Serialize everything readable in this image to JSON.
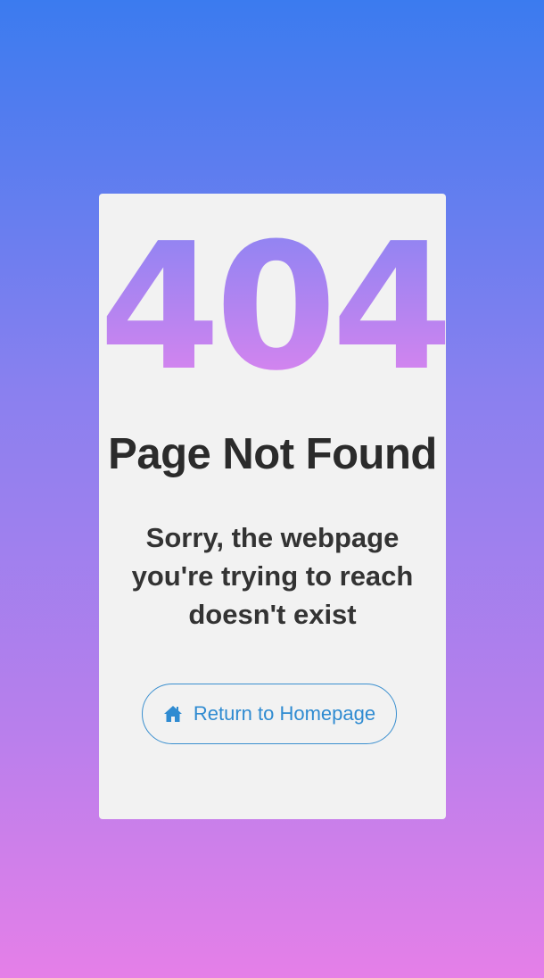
{
  "error": {
    "code": "404",
    "title": "Page Not Found",
    "message": "Sorry, the webpage you're trying to reach doesn't exist"
  },
  "actions": {
    "home_button_label": "Return to Homepage",
    "home_icon": "home-icon"
  },
  "colors": {
    "background_top": "#3b7bef",
    "background_bottom": "#e57fe8",
    "card_background": "#f2f2f2",
    "accent": "#2f8bd1",
    "text": "#2b2b2b"
  }
}
